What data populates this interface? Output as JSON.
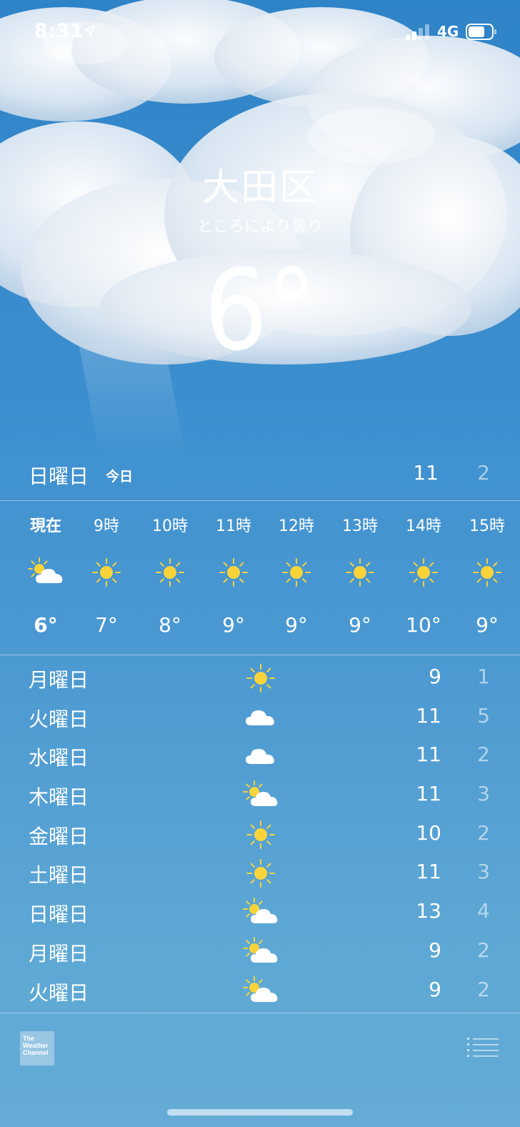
{
  "status_bar": {
    "time": "8:31",
    "network": "4G",
    "icons": [
      "location-arrow-icon",
      "signal-icon",
      "battery-icon"
    ]
  },
  "location": {
    "city": "大田区",
    "condition": "ところにより曇り",
    "current_temp": "6°"
  },
  "today": {
    "day": "日曜日",
    "tag": "今日",
    "high": "11",
    "low": "2"
  },
  "hourly": [
    {
      "label": "現在",
      "icon": "partly-cloudy-icon",
      "temp": "6°"
    },
    {
      "label": "9時",
      "icon": "sun-icon",
      "temp": "7°"
    },
    {
      "label": "10時",
      "icon": "sun-icon",
      "temp": "8°"
    },
    {
      "label": "11時",
      "icon": "sun-icon",
      "temp": "9°"
    },
    {
      "label": "12時",
      "icon": "sun-icon",
      "temp": "9°"
    },
    {
      "label": "13時",
      "icon": "sun-icon",
      "temp": "9°"
    },
    {
      "label": "14時",
      "icon": "sun-icon",
      "temp": "10°"
    },
    {
      "label": "15時",
      "icon": "sun-icon",
      "temp": "9°"
    }
  ],
  "daily": [
    {
      "day": "月曜日",
      "icon": "sun-icon",
      "high": "9",
      "low": "1"
    },
    {
      "day": "火曜日",
      "icon": "cloud-icon",
      "high": "11",
      "low": "5"
    },
    {
      "day": "水曜日",
      "icon": "cloud-icon",
      "high": "11",
      "low": "2"
    },
    {
      "day": "木曜日",
      "icon": "partly-cloudy-icon",
      "high": "11",
      "low": "3"
    },
    {
      "day": "金曜日",
      "icon": "sun-icon",
      "high": "10",
      "low": "2"
    },
    {
      "day": "土曜日",
      "icon": "sun-icon",
      "high": "11",
      "low": "3"
    },
    {
      "day": "日曜日",
      "icon": "partly-cloudy-icon",
      "high": "13",
      "low": "4"
    },
    {
      "day": "月曜日",
      "icon": "partly-cloudy-icon",
      "high": "9",
      "low": "2"
    },
    {
      "day": "火曜日",
      "icon": "partly-cloudy-icon",
      "high": "9",
      "low": "2"
    }
  ],
  "footer": {
    "logo_lines": [
      "The",
      "Weather",
      "Channel"
    ],
    "list_button_icon": "list-icon"
  },
  "colors": {
    "sun": "#f8d43a",
    "sky_top": "#2f83c7",
    "sky_bottom": "#64acd6"
  }
}
